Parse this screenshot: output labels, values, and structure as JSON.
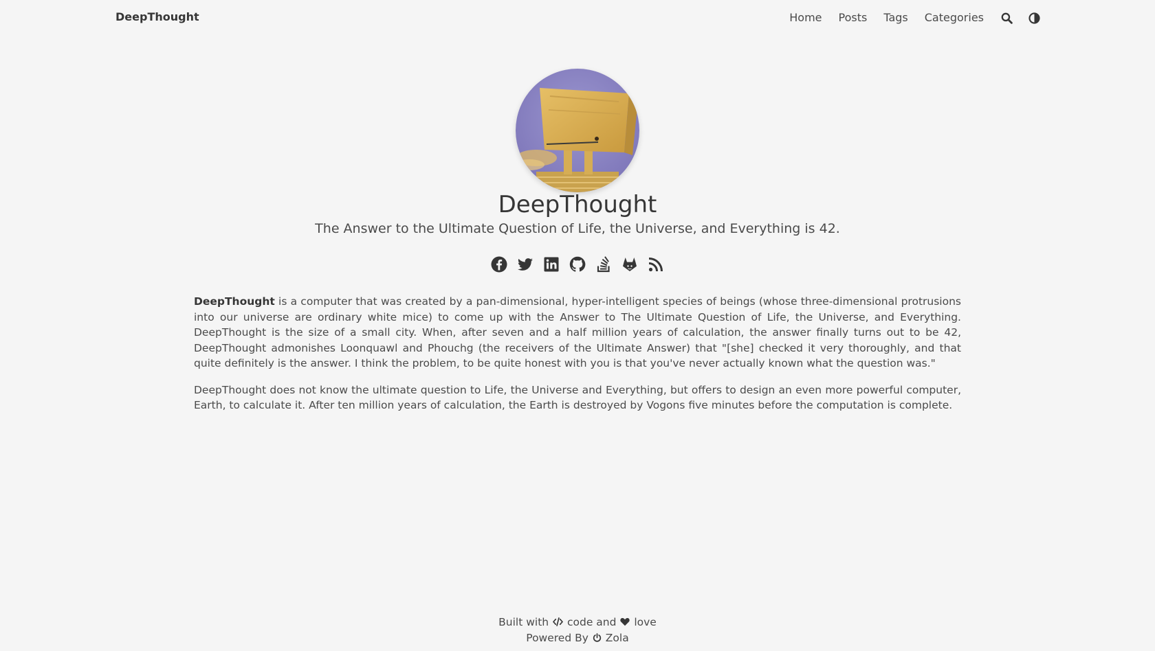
{
  "navbar": {
    "brand": "DeepThought",
    "links": [
      "Home",
      "Posts",
      "Tags",
      "Categories"
    ],
    "icons": [
      "search-icon",
      "theme-toggle-icon"
    ]
  },
  "hero": {
    "avatar": "deep-thought-avatar",
    "title": "DeepThought",
    "subtitle": "The Answer to the Ultimate Question of Life, the Universe, and Everything is 42."
  },
  "socials": [
    "facebook-icon",
    "twitter-icon",
    "linkedin-icon",
    "github-icon",
    "stackoverflow-icon",
    "gitlab-icon",
    "rss-icon"
  ],
  "content": {
    "p1_bold": "DeepThought",
    "p1_rest": " is a computer that was created by a pan-dimensional, hyper-intelligent species of beings (whose three-dimensional protrusions into our universe are ordinary white mice) to come up with the Answer to The Ultimate Question of Life, the Universe, and Everything. DeepThought is the size of a small city. When, after seven and a half million years of calculation, the answer finally turns out to be 42, DeepThought admonishes Loonquawl and Phouchg (the receivers of the Ultimate Answer) that \"[she] checked it very thoroughly, and that quite definitely is the answer. I think the problem, to be quite honest with you is that you've never actually known what the question was.\"",
    "p2": "DeepThought does not know the ultimate question to Life, the Universe and Everything, but offers to design an even more powerful computer, Earth, to calculate it. After ten million years of calculation, the Earth is destroyed by Vogons five minutes before the computation is complete."
  },
  "footer": {
    "built_with": "Built with",
    "code": "code and",
    "love": "love",
    "powered_by": "Powered By",
    "zola": "Zola"
  },
  "colors": {
    "background": "#f5f5f5",
    "text": "#363636",
    "avatar_bg": "#8b84c4",
    "avatar_gold": "#d8a94a"
  }
}
